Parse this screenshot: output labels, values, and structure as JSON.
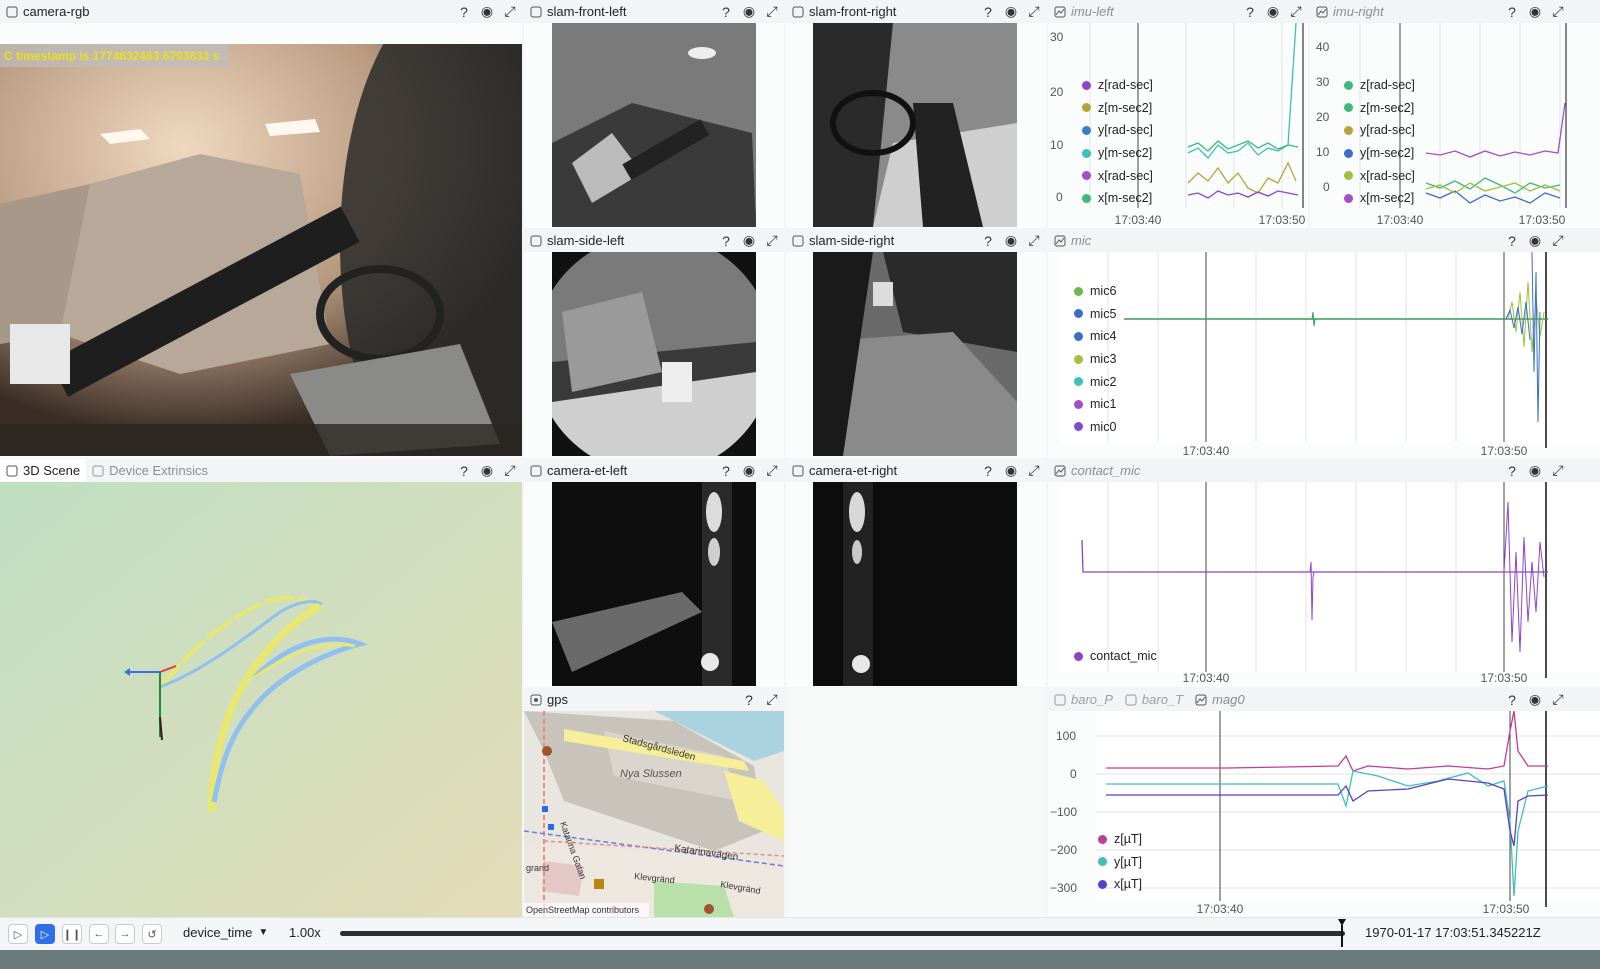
{
  "panels": {
    "camera_rgb": {
      "title": "camera-rgb",
      "overlay": "C timestamp is 1774632463.6793633 s"
    },
    "slam_front_left": {
      "title": "slam-front-left"
    },
    "slam_front_right": {
      "title": "slam-front-right"
    },
    "slam_side_left": {
      "title": "slam-side-left"
    },
    "slam_side_right": {
      "title": "slam-side-right"
    },
    "camera_et_left": {
      "title": "camera-et-left"
    },
    "camera_et_right": {
      "title": "camera-et-right"
    },
    "scene": {
      "tab_active": "3D Scene",
      "tab_inactive": "Device Extrinsics"
    },
    "gps": {
      "title": "gps",
      "attribution": "OpenStreetMap contributors",
      "labels": [
        "Stadsgårdsleden",
        "Nya Slussen",
        "Katarinavägen",
        "Katarina Gatan",
        "Klevgränd",
        "Klevgränd",
        "grand"
      ]
    },
    "imu_left": {
      "title": "imu-left",
      "legend": [
        "z[rad-sec]",
        "z[m-sec2]",
        "y[rad-sec]",
        "y[m-sec2]",
        "x[rad-sec]",
        "x[m-sec2]"
      ],
      "yticks": [
        "30",
        "20",
        "10",
        "0"
      ],
      "xticks": [
        "17:03:40",
        "17:03:50"
      ]
    },
    "imu_right": {
      "title": "imu-right",
      "legend": [
        "z[rad-sec]",
        "z[m-sec2]",
        "y[rad-sec]",
        "y[m-sec2]",
        "x[rad-sec]",
        "x[m-sec2]"
      ],
      "yticks": [
        "40",
        "30",
        "20",
        "10",
        "0"
      ],
      "xticks": [
        "17:03:40",
        "17:03:50"
      ]
    },
    "mic": {
      "title": "mic",
      "legend": [
        "mic6",
        "mic5",
        "mic4",
        "mic3",
        "mic2",
        "mic1",
        "mic0"
      ],
      "xticks": [
        "17:03:40",
        "17:03:50"
      ]
    },
    "contact_mic": {
      "title": "contact_mic",
      "legend": [
        "contact_mic"
      ],
      "xticks": [
        "17:03:40",
        "17:03:50"
      ]
    },
    "mag": {
      "tabs": [
        "baro_P",
        "baro_T",
        "mag0"
      ],
      "legend": [
        "z[µT]",
        "y[µT]",
        "x[µT]"
      ],
      "yticks": [
        "100",
        "0",
        "−100",
        "−200",
        "−300"
      ],
      "xticks": [
        "17:03:40",
        "17:03:50"
      ]
    }
  },
  "icons": {
    "help": "?",
    "visibility": "eye-icon",
    "maximize": "expand-icon"
  },
  "timebar": {
    "timeline": "device_time",
    "speed": "1.00x",
    "time": "1970-01-17 17:03:51.345221Z"
  },
  "colors": {
    "purple": "#8e44c9",
    "green": "#3cba7c",
    "olive": "#b8a33a",
    "blue": "#3a6fc9",
    "teal": "#3ec0b8",
    "violet": "#7a4fc9",
    "lime": "#9ec23c",
    "magenta": "#c23c96"
  }
}
